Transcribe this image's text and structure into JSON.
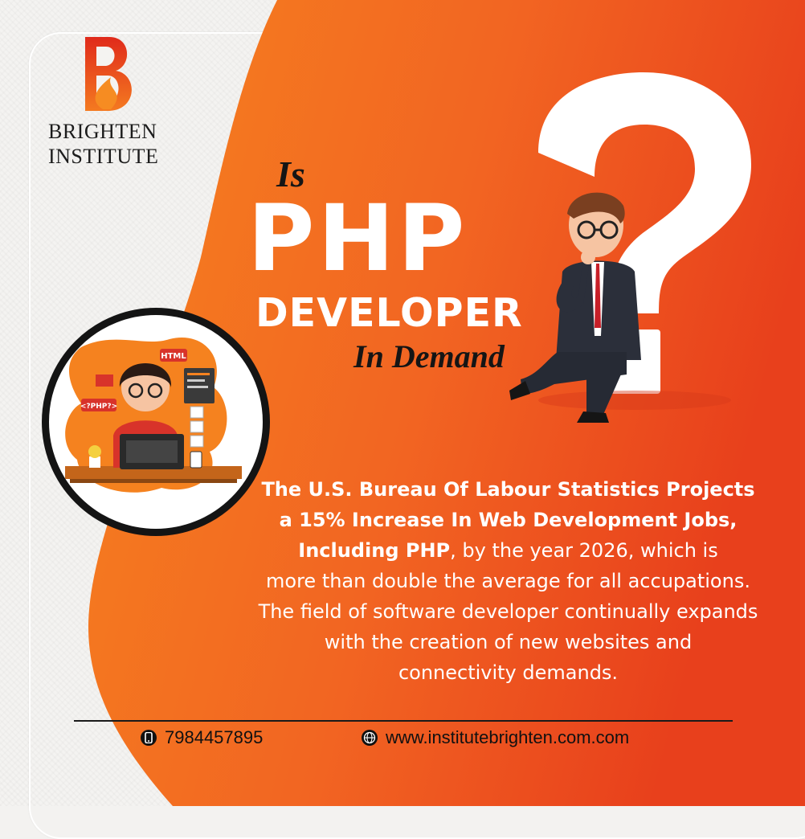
{
  "brand": {
    "name_line1": "BRIGHTEN",
    "name_line2": "INSTITUTE",
    "logo_icon": "brighten-b-flame-logo"
  },
  "headline": {
    "is": "Is",
    "php": "PHP",
    "developer": "DEVELOPER",
    "in_demand": "In Demand"
  },
  "illustration": {
    "html_tag": "HTML",
    "php_tag": "<?PHP?>"
  },
  "body": {
    "line1": "The U.S. Bureau Of Labour Statistics Projects",
    "line2": "a 15% Increase In Web Development Jobs,",
    "line3_bold": "Including PHP",
    "line3_rest": ", by the year 2026, which is",
    "line4": "more than double the average for all accupations.",
    "line5": "The field of software developer continually expands",
    "line6": "with the creation of  new websites and",
    "line7": "connectivity demands."
  },
  "contact": {
    "phone": "7984457895",
    "phone_icon": "phone-icon",
    "website": "www.institutebrighten.com.com",
    "website_icon": "globe-icon"
  },
  "colors": {
    "orange_start": "#f5821f",
    "orange_end": "#e8401c",
    "dark": "#141414"
  }
}
